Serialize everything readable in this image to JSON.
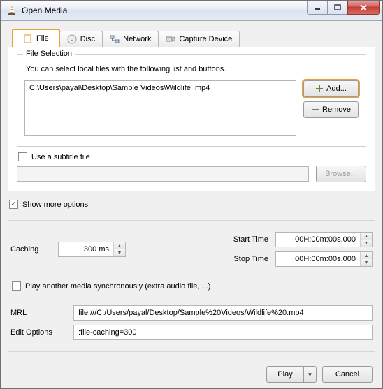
{
  "window": {
    "title": "Open Media"
  },
  "tabs": [
    {
      "label": "File",
      "icon": "file-icon",
      "active": true
    },
    {
      "label": "Disc",
      "icon": "disc-icon",
      "active": false
    },
    {
      "label": "Network",
      "icon": "network-icon",
      "active": false
    },
    {
      "label": "Capture Device",
      "icon": "capture-icon",
      "active": false
    }
  ],
  "file_selection": {
    "legend": "File Selection",
    "hint": "You can select local files with the following list and buttons.",
    "files": [
      "C:\\Users\\payal\\Desktop\\Sample Videos\\Wildlife .mp4"
    ],
    "add_label": "Add...",
    "remove_label": "Remove"
  },
  "subtitle": {
    "checkbox_label": "Use a subtitle file",
    "checked": false,
    "path": "",
    "browse_label": "Browse..."
  },
  "show_more": {
    "label": "Show more options",
    "checked": true
  },
  "options": {
    "caching_label": "Caching",
    "caching_value": "300 ms",
    "start_label": "Start Time",
    "start_value": "00H:00m:00s.000",
    "stop_label": "Stop Time",
    "stop_value": "00H:00m:00s.000",
    "play_sync_label": "Play another media synchronously (extra audio file, ...)",
    "play_sync_checked": false,
    "mrl_label": "MRL",
    "mrl_value": "file:///C:/Users/payal/Desktop/Sample%20Videos/Wildlife%20.mp4",
    "edit_label": "Edit Options",
    "edit_value": ":file-caching=300"
  },
  "footer": {
    "play_label": "Play",
    "cancel_label": "Cancel"
  }
}
